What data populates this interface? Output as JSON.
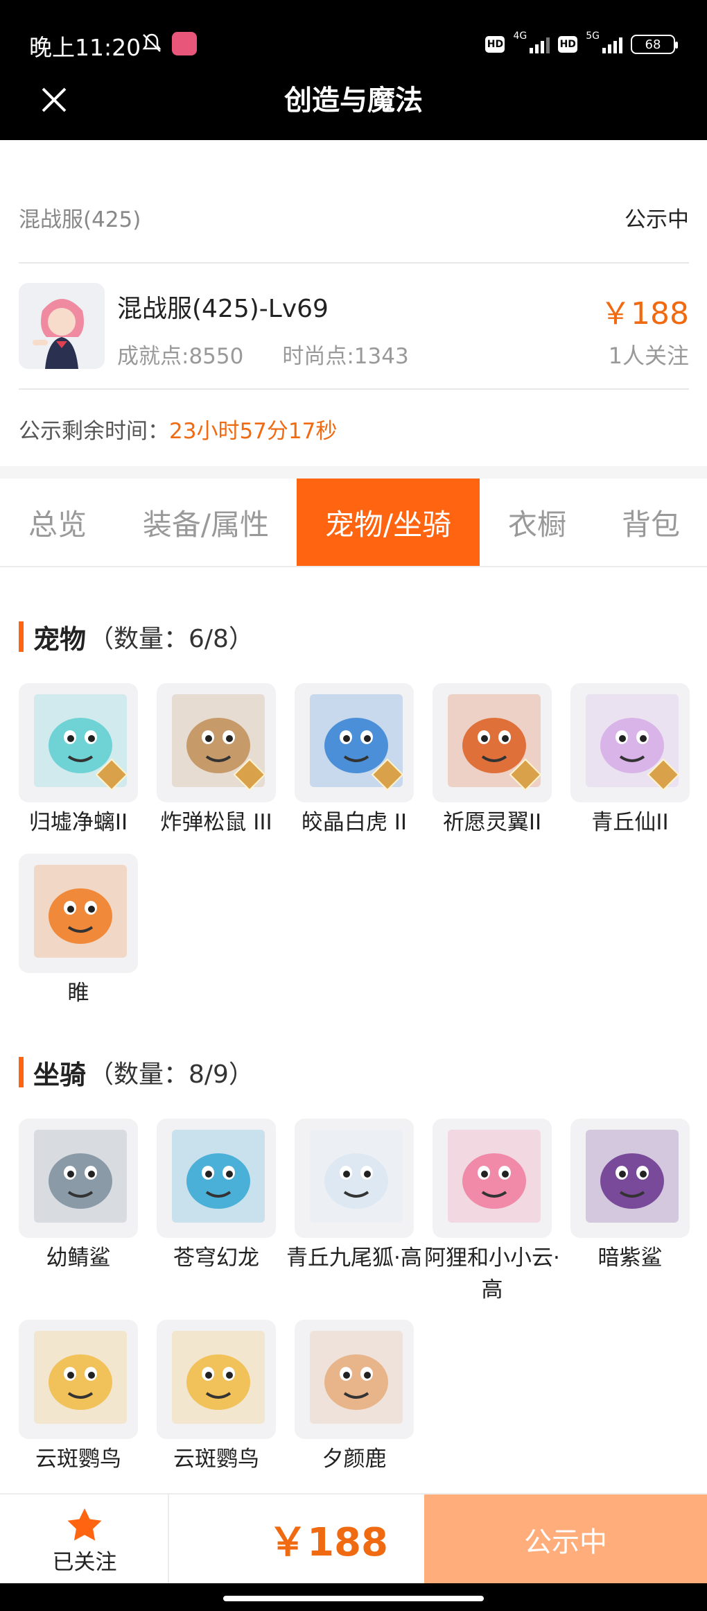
{
  "status_bar": {
    "time": "晚上11:20",
    "net1": "4G",
    "net2": "5G",
    "hd": "HD",
    "battery": "68"
  },
  "header": {
    "title": "创造与魔法"
  },
  "info": {
    "server": "混战服(425)",
    "state": "公示中",
    "character_name": "混战服(425)-Lv69",
    "achievement": "成就点:8550",
    "fashion": "时尚点:1343",
    "price": "￥188",
    "followers": "1人关注",
    "countdown_label": "公示剩余时间：",
    "countdown_value": "23小时57分17秒"
  },
  "tabs": [
    "总览",
    "装备/属性",
    "宠物/坐骑",
    "衣橱",
    "背包"
  ],
  "active_tab": 2,
  "pets": {
    "title": "宠物",
    "count": "（数量：6/8）",
    "items": [
      {
        "label": "归墟净螭II",
        "icon": "dragon-cyan",
        "color": "#6fd3d6",
        "grade": "II"
      },
      {
        "label": "炸弹松鼠 III",
        "icon": "squirrel",
        "color": "#c79a6a",
        "grade": "III"
      },
      {
        "label": "皎晶白虎 II",
        "icon": "white-tiger",
        "color": "#4a8fd8",
        "grade": "II"
      },
      {
        "label": "祈愿灵翼II",
        "icon": "griffin",
        "color": "#e0703a",
        "grade": "II"
      },
      {
        "label": "青丘仙II",
        "icon": "fox-fairy",
        "color": "#d9b4e8",
        "grade": "II"
      },
      {
        "label": "睢",
        "icon": "fire-bird",
        "color": "#f08a3a",
        "grade": ""
      }
    ]
  },
  "mounts": {
    "title": "坐骑",
    "count": "（数量：8/9）",
    "items": [
      {
        "label": "幼鲭鲨",
        "icon": "shark",
        "color": "#8a9aa6"
      },
      {
        "label": "苍穹幻龙",
        "icon": "sky-dragon",
        "color": "#4bb0d8"
      },
      {
        "label": "青丘九尾狐·高",
        "icon": "nine-tail-fox",
        "color": "#dde8f2"
      },
      {
        "label": "阿狸和小小云·高",
        "icon": "ali-cloud",
        "color": "#f08aa8"
      },
      {
        "label": "暗紫鲨",
        "icon": "purple-shark",
        "color": "#7a4a9a"
      },
      {
        "label": "云斑鹦鸟",
        "icon": "parrot",
        "color": "#f2c25a"
      },
      {
        "label": "云斑鹦鸟",
        "icon": "parrot",
        "color": "#f2c25a"
      },
      {
        "label": "夕颜鹿",
        "icon": "deer",
        "color": "#e8b48a"
      }
    ]
  },
  "bottom_bar": {
    "follow_label": "已关注",
    "price": "￥188",
    "action_label": "公示中"
  },
  "colors": {
    "accent": "#ff6410",
    "price": "#f06a12",
    "action_disabled": "#ffad7a"
  }
}
